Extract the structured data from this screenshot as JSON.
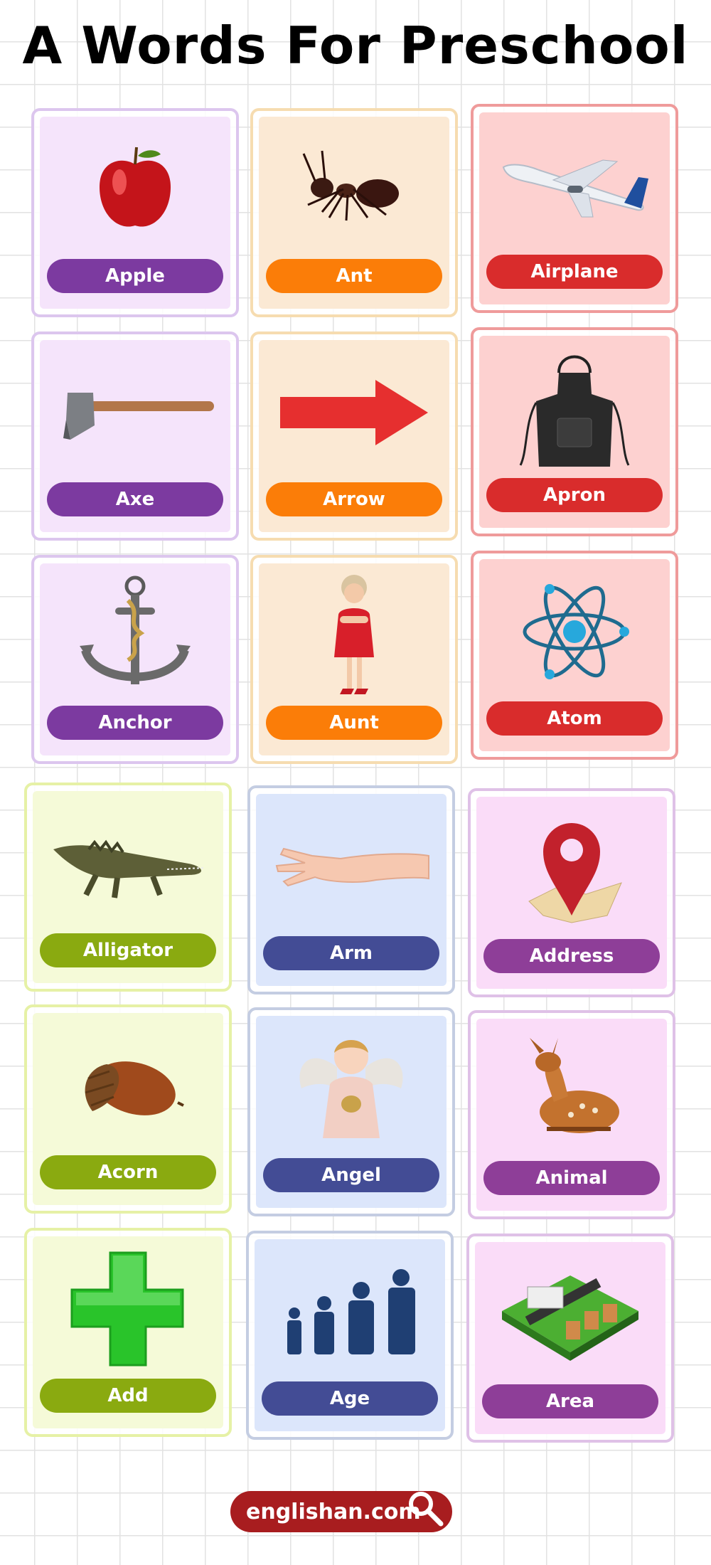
{
  "title": "A Words For Preschool",
  "colors": {
    "purple": {
      "bg": "#f5e4fb",
      "border": "#dcc6ee",
      "label": "#7c3aa0"
    },
    "orange": {
      "bg": "#fbe9d4",
      "border": "#f6dcb0",
      "label": "#fb7d08"
    },
    "red": {
      "bg": "#fdd1d0",
      "border": "#ef9b9b",
      "label": "#d92c2c"
    },
    "lime": {
      "bg": "#f5fad8",
      "border": "#e6f1a6",
      "label": "#8aaa10"
    },
    "blue": {
      "bg": "#dce6fb",
      "border": "#c4cde2",
      "label": "#434c95"
    },
    "pink": {
      "bg": "#fadcf8",
      "border": "#dfc1e7",
      "label": "#8e3e98"
    }
  },
  "cards": [
    {
      "label": "Apple",
      "icon": "apple-icon"
    },
    {
      "label": "Ant",
      "icon": "ant-icon"
    },
    {
      "label": "Airplane",
      "icon": "airplane-icon"
    },
    {
      "label": "Axe",
      "icon": "axe-icon"
    },
    {
      "label": "Arrow",
      "icon": "arrow-icon"
    },
    {
      "label": "Apron",
      "icon": "apron-icon"
    },
    {
      "label": "Anchor",
      "icon": "anchor-icon"
    },
    {
      "label": "Aunt",
      "icon": "aunt-icon"
    },
    {
      "label": "Atom",
      "icon": "atom-icon"
    },
    {
      "label": "Alligator",
      "icon": "alligator-icon"
    },
    {
      "label": "Arm",
      "icon": "arm-icon"
    },
    {
      "label": "Address",
      "icon": "location-pin-icon"
    },
    {
      "label": "Acorn",
      "icon": "acorn-icon"
    },
    {
      "label": "Angel",
      "icon": "angel-icon"
    },
    {
      "label": "Animal",
      "icon": "deer-icon"
    },
    {
      "label": "Add",
      "icon": "plus-icon"
    },
    {
      "label": "Age",
      "icon": "people-ages-icon"
    },
    {
      "label": "Area",
      "icon": "city-area-icon"
    }
  ],
  "footer": {
    "text": "englishan.com",
    "icon": "search-icon"
  }
}
